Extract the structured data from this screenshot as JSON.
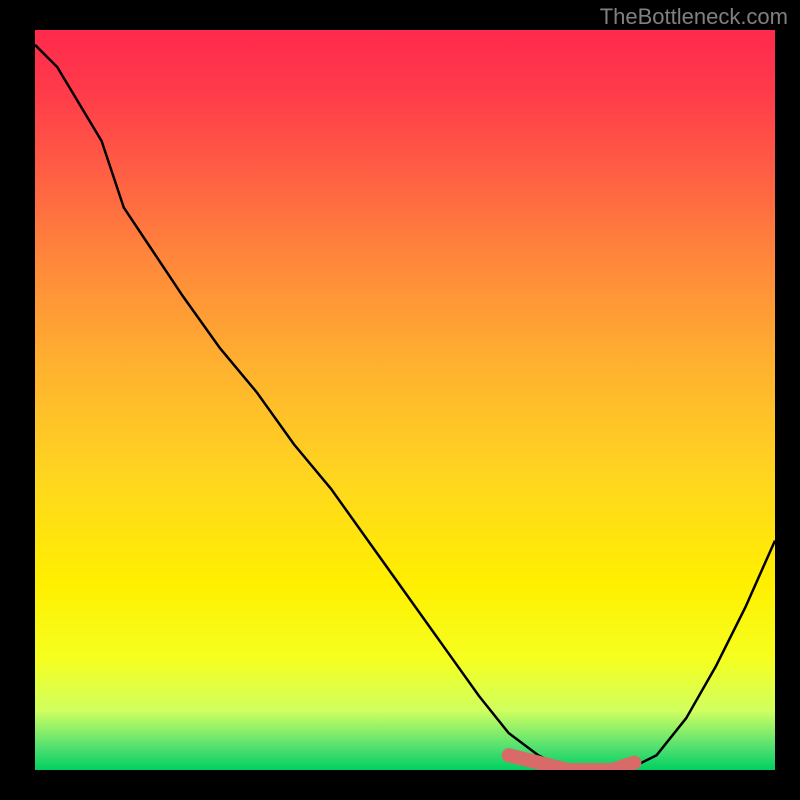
{
  "watermark": "TheBottleneck.com",
  "chart_data": {
    "type": "line",
    "title": "",
    "xlabel": "",
    "ylabel": "",
    "xlim": [
      0,
      100
    ],
    "ylim": [
      0,
      100
    ],
    "series": [
      {
        "name": "curve",
        "x": [
          0,
          3,
          6,
          9,
          12,
          16,
          20,
          25,
          30,
          35,
          40,
          45,
          50,
          55,
          60,
          64,
          68,
          72,
          75,
          78,
          80,
          84,
          88,
          92,
          96,
          100
        ],
        "y": [
          98,
          95,
          90,
          85,
          76,
          70,
          64,
          57,
          51,
          44,
          38,
          31,
          24,
          17,
          10,
          5,
          2,
          0,
          0,
          0,
          0,
          2,
          7,
          14,
          22,
          31
        ]
      },
      {
        "name": "highlight",
        "x": [
          64,
          68,
          72,
          75,
          78,
          81
        ],
        "y": [
          2,
          1,
          0,
          0,
          0,
          1
        ]
      }
    ]
  }
}
